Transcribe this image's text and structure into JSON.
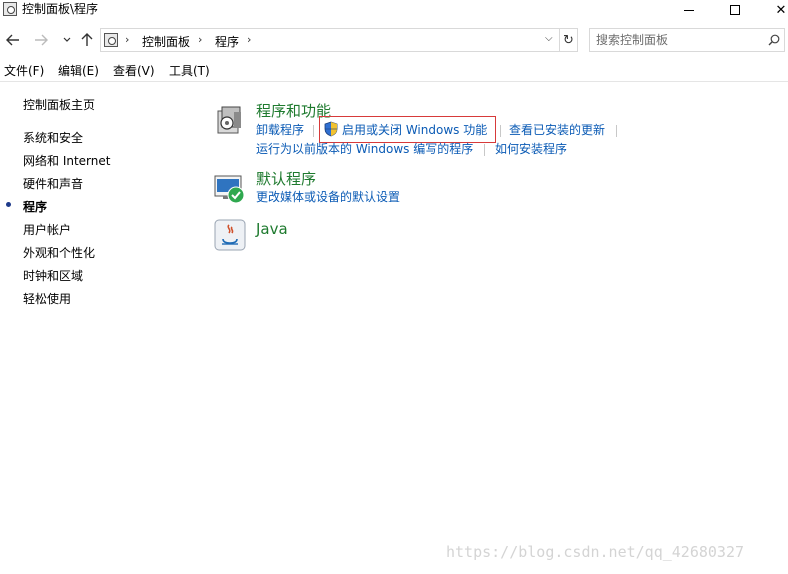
{
  "window": {
    "title": "控制面板\\程序",
    "minimize_label": "",
    "maximize_label": "",
    "close_label": "✕"
  },
  "address": {
    "sep0": "›",
    "crumbs": [
      "控制面板",
      "程序"
    ],
    "sep1": "›",
    "sep2": "›",
    "dropdown": "⌵",
    "refresh": "↻"
  },
  "search": {
    "placeholder": "搜索控制面板"
  },
  "menu": {
    "items": [
      "文件(F)",
      "编辑(E)",
      "查看(V)",
      "工具(T)"
    ]
  },
  "leftnav": {
    "home": "控制面板主页",
    "items": [
      "系统和安全",
      "网络和 Internet",
      "硬件和声音",
      "程序",
      "用户帐户",
      "外观和个性化",
      "时钟和区域",
      "轻松使用"
    ],
    "current": "程序"
  },
  "categories": {
    "programs": {
      "title": "程序和功能",
      "links": [
        "卸载程序",
        "启用或关闭 Windows 功能",
        "查看已安装的更新",
        "运行为以前版本的 Windows 编写的程序",
        "如何安装程序"
      ]
    },
    "defaults": {
      "title": "默认程序",
      "links": [
        "更改媒体或设备的默认设置"
      ]
    },
    "java": {
      "title": "Java"
    }
  },
  "watermark": "https://blog.csdn.net/qq_42680327",
  "colors": {
    "category_title": "#1e7a2e",
    "link": "#0b5bb5",
    "highlight": "#d73a3a"
  }
}
